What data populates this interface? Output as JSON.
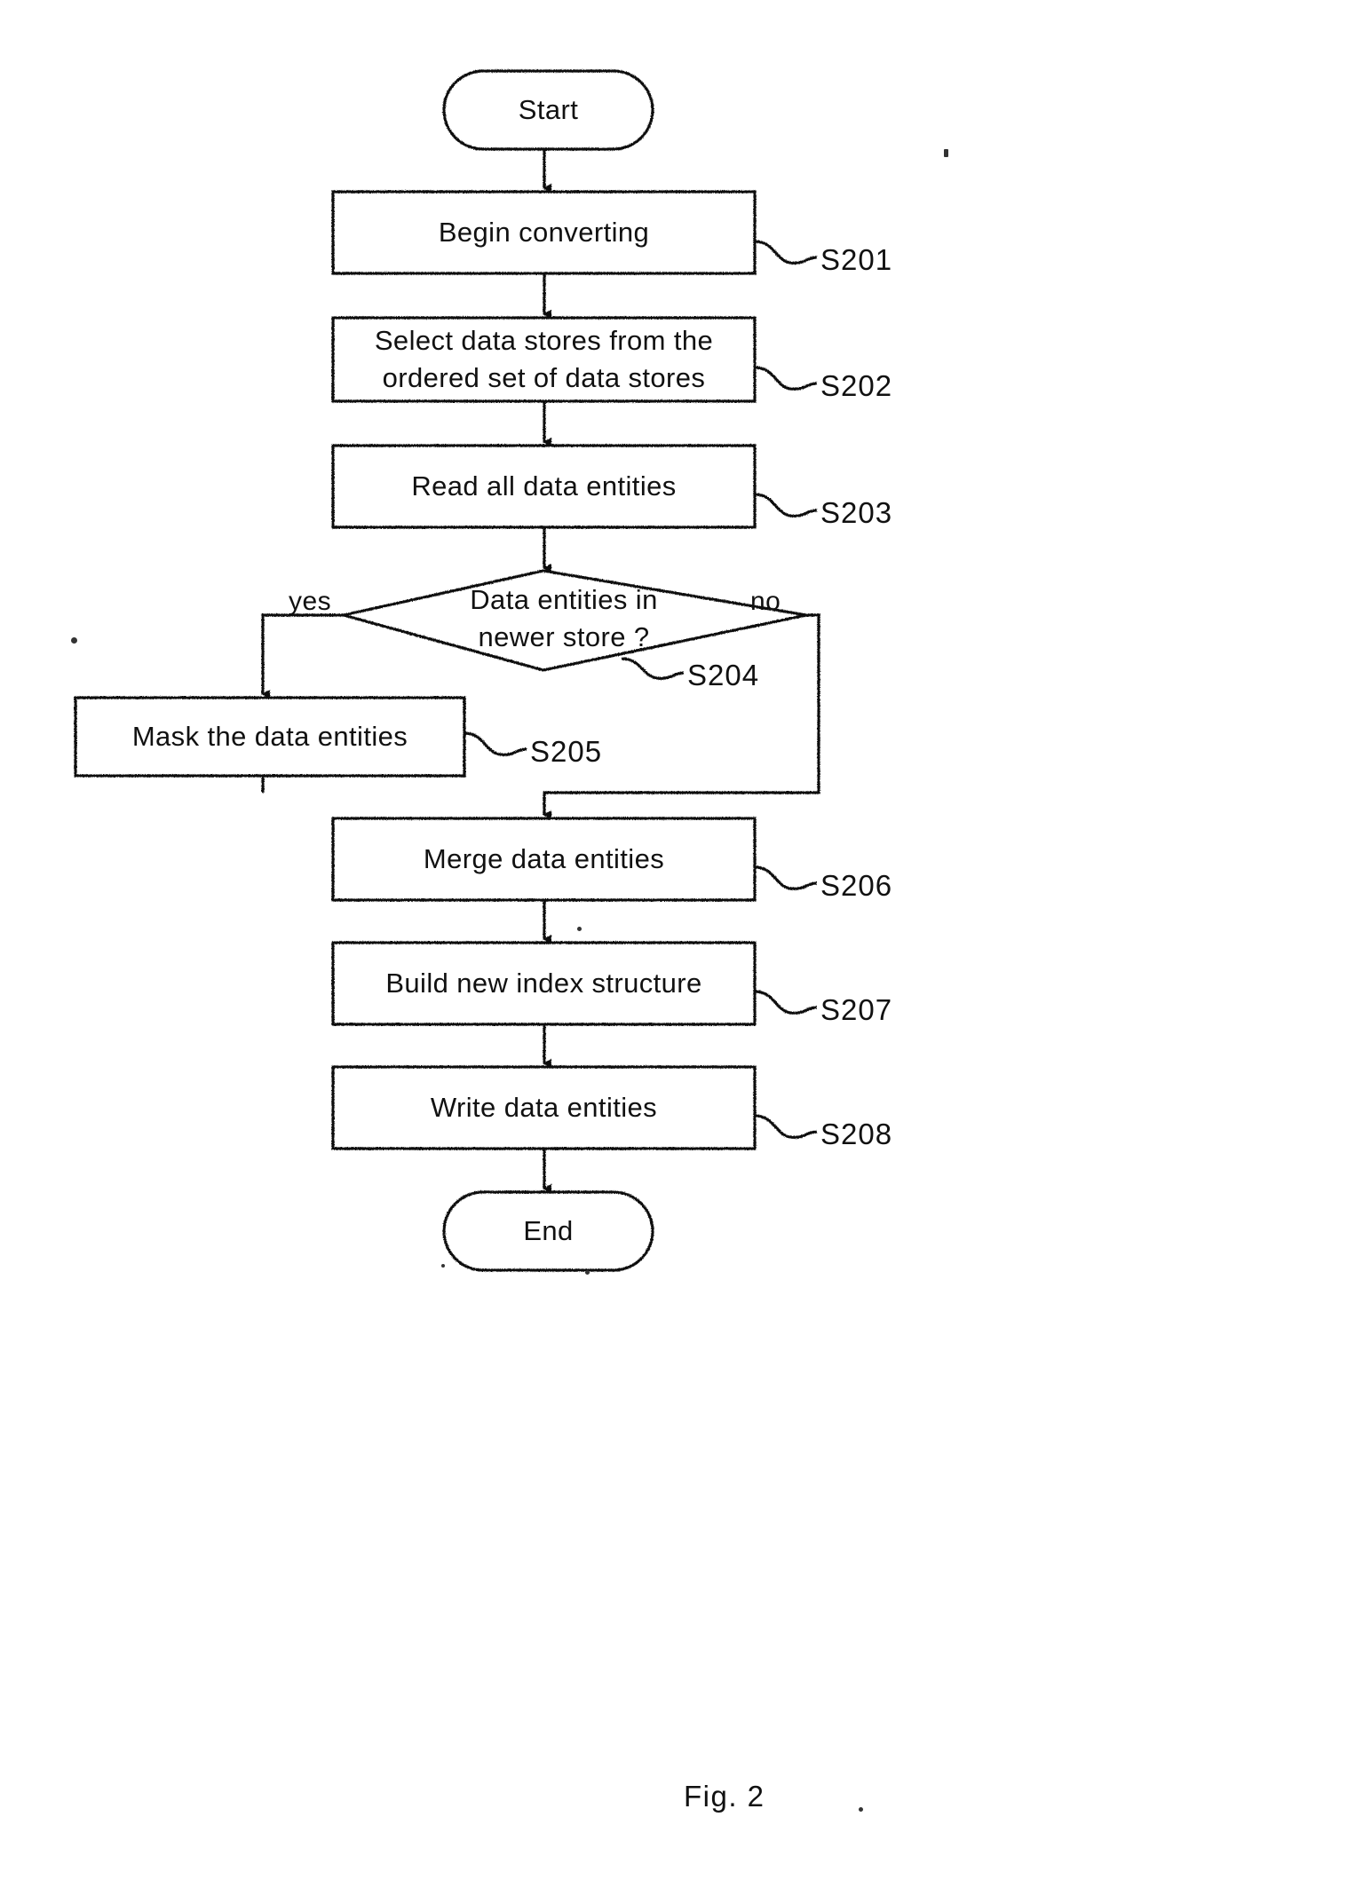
{
  "figure": {
    "caption": "Fig. 2",
    "type": "flowchart"
  },
  "chart_data": {
    "type": "diagram",
    "title": "Fig. 2",
    "nodes": [
      {
        "id": "start",
        "shape": "terminator",
        "label": "Start",
        "ref": ""
      },
      {
        "id": "s201",
        "shape": "process",
        "label": "Begin converting",
        "ref": "S201"
      },
      {
        "id": "s202",
        "shape": "process",
        "label": "Select data stores from the\nordered set of data stores",
        "ref": "S202"
      },
      {
        "id": "s203",
        "shape": "process",
        "label": "Read all data entities",
        "ref": "S203"
      },
      {
        "id": "s204",
        "shape": "decision",
        "label": "Data entities in\nnewer store ?",
        "ref": "S204"
      },
      {
        "id": "s205",
        "shape": "process",
        "label": "Mask the data entities",
        "ref": "S205"
      },
      {
        "id": "s206",
        "shape": "process",
        "label": "Merge data entities",
        "ref": "S206"
      },
      {
        "id": "s207",
        "shape": "process",
        "label": "Build new index structure",
        "ref": "S207"
      },
      {
        "id": "s208",
        "shape": "process",
        "label": "Write data entities",
        "ref": "S208"
      },
      {
        "id": "end",
        "shape": "terminator",
        "label": "End",
        "ref": ""
      }
    ],
    "edges": [
      {
        "from": "start",
        "to": "s201",
        "label": ""
      },
      {
        "from": "s201",
        "to": "s202",
        "label": ""
      },
      {
        "from": "s202",
        "to": "s203",
        "label": ""
      },
      {
        "from": "s203",
        "to": "s204",
        "label": ""
      },
      {
        "from": "s204",
        "to": "s205",
        "label": "yes"
      },
      {
        "from": "s204",
        "to": "s206",
        "label": "no"
      },
      {
        "from": "s205",
        "to": "s206",
        "label": ""
      },
      {
        "from": "s206",
        "to": "s207",
        "label": ""
      },
      {
        "from": "s207",
        "to": "s208",
        "label": ""
      },
      {
        "from": "s208",
        "to": "end",
        "label": ""
      }
    ],
    "branch_labels": {
      "yes": "yes",
      "no": "no"
    },
    "colors": {
      "stroke": "#111111",
      "fill": "#ffffff",
      "text": "#111111"
    }
  }
}
